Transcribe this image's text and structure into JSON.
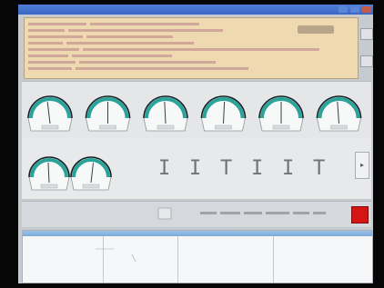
{
  "window": {
    "title": ""
  },
  "log": {
    "lines": [
      "",
      "",
      "",
      "",
      "",
      "",
      "",
      "",
      ""
    ]
  },
  "gauges": {
    "top": [
      {
        "label": "",
        "value": 0.45
      },
      {
        "label": "",
        "value": 0.5
      },
      {
        "label": "",
        "value": 0.48
      },
      {
        "label": "",
        "value": 0.52
      },
      {
        "label": "",
        "value": 0.5
      },
      {
        "label": "",
        "value": 0.47
      }
    ],
    "bottom": [
      {
        "label": "",
        "value": 0.48
      },
      {
        "label": "",
        "value": 0.55
      }
    ]
  },
  "readouts": [
    "I",
    "I",
    "T",
    "I",
    "I",
    "T"
  ],
  "toolbar": {
    "left_label": "",
    "stop_color": "#d51414"
  },
  "colors": {
    "gauge_arc": "#2aa39a",
    "gauge_bg": "#f7f8f8"
  }
}
